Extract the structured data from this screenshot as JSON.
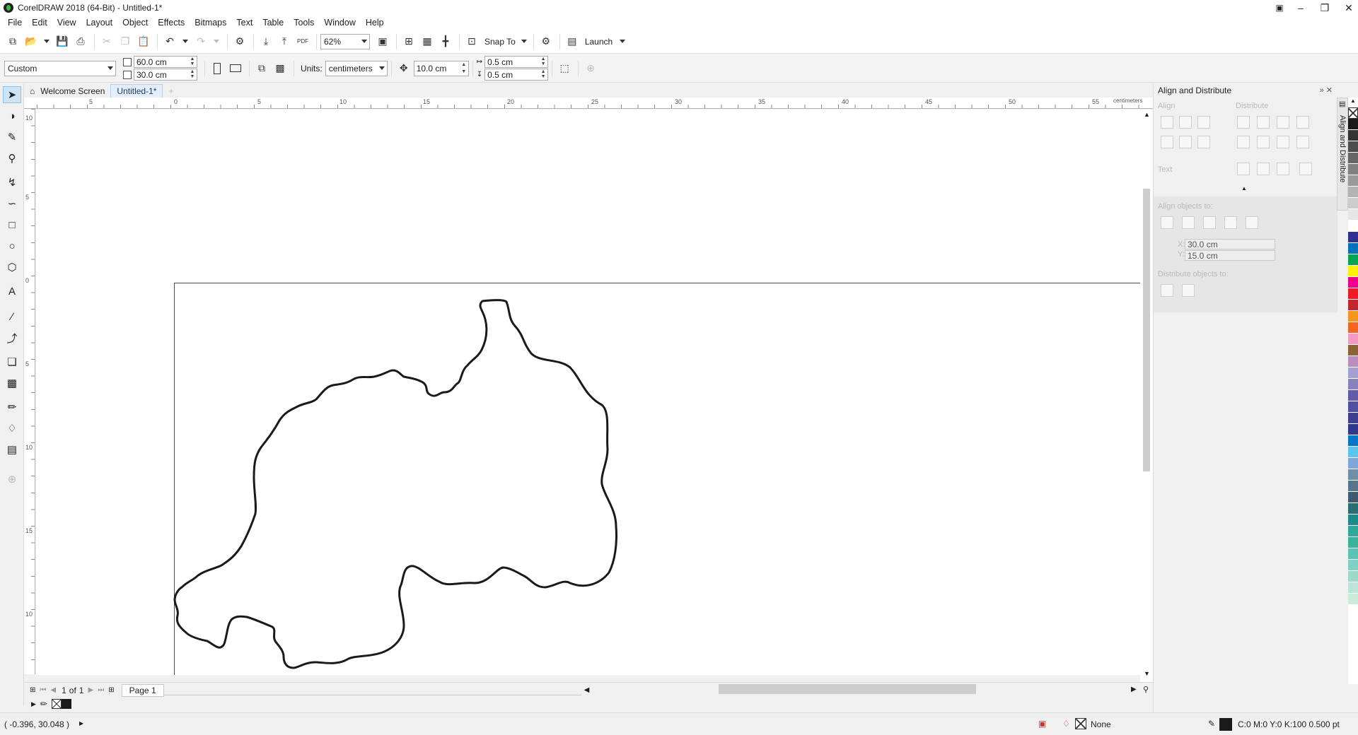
{
  "window": {
    "title": "CorelDRAW 2018 (64-Bit) - Untitled-1*",
    "controls": [
      "minimize",
      "restore",
      "close"
    ]
  },
  "menu": [
    "File",
    "Edit",
    "View",
    "Layout",
    "Object",
    "Effects",
    "Bitmaps",
    "Text",
    "Table",
    "Tools",
    "Window",
    "Help"
  ],
  "standard_toolbar": {
    "zoom": "62%",
    "snap_to": "Snap To",
    "launch": "Launch",
    "pdf_label": "PDF"
  },
  "property_bar": {
    "page_preset": "Custom",
    "width": "60.0 cm",
    "height": "30.0 cm",
    "units_label": "Units:",
    "units": "centimeters",
    "nudge": "10.0 cm",
    "dup_x": "0.5 cm",
    "dup_y": "0.5 cm"
  },
  "tabs": {
    "welcome": "Welcome Screen",
    "document": "Untitled-1*"
  },
  "ruler": {
    "units": "centimeters",
    "h_labels": [
      "5",
      "0",
      "5",
      "10",
      "15",
      "20",
      "25",
      "30",
      "35",
      "40",
      "45",
      "50",
      "55"
    ],
    "v_labels": [
      "10",
      "5",
      "0",
      "5",
      "10",
      "15",
      "10"
    ]
  },
  "page_nav": {
    "current": "1",
    "of_label": "of",
    "total": "1",
    "page_tab": "Page 1"
  },
  "status": {
    "cursor_coords": "( -0.396, 30.048 )",
    "fill": "None",
    "outline": "C:0 M:0 Y:0 K:100  0.500 pt"
  },
  "docker": {
    "title": "Align and Distribute",
    "tab_label": "Align and Distribute",
    "align_label": "Align",
    "distribute_label": "Distribute",
    "text_label": "Text",
    "align_objects_label": "Align objects to:",
    "x_label": "X:",
    "x_value": "30.0 cm",
    "y_label": "Y:",
    "y_value": "15.0 cm",
    "distribute_objects_label": "Distribute objects to:"
  },
  "palette_colors": [
    "#1a1a1a",
    "#333333",
    "#4d4d4d",
    "#666666",
    "#808080",
    "#999999",
    "#b3b3b3",
    "#cccccc",
    "#e6e6e6",
    "#ffffff",
    "#2e3192",
    "#0072bc",
    "#00a651",
    "#fff200",
    "#ec008c",
    "#ed1c24",
    "#c1272d",
    "#f7941d",
    "#f26522",
    "#f49ac2",
    "#8c6239",
    "#bd8cbf",
    "#a3a0d3",
    "#8781bd",
    "#605ca8",
    "#524fa1",
    "#3f3f8f",
    "#2f3a8f",
    "#0077c8",
    "#5cc5ef",
    "#7da7d9",
    "#6d8fa8",
    "#56748c",
    "#3f5a6e",
    "#2a6e73",
    "#1f8a8a",
    "#2fa89a",
    "#3bb39b",
    "#58c4b8",
    "#7fd0c5",
    "#9ed8c8",
    "#bde4d8",
    "#c9ecd8"
  ]
}
